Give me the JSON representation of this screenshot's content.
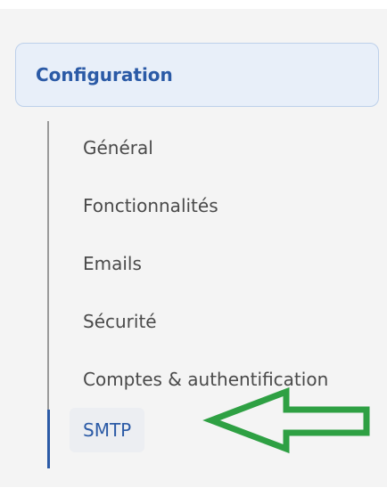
{
  "section": {
    "title": "Configuration"
  },
  "nav": {
    "items": [
      {
        "label": "Général"
      },
      {
        "label": "Fonctionnalités"
      },
      {
        "label": "Emails"
      },
      {
        "label": "Sécurité"
      },
      {
        "label": "Comptes & authentification"
      },
      {
        "label": "SMTP",
        "active": true
      }
    ]
  },
  "colors": {
    "accent": "#2b5aa6",
    "arrow": "#2ea043",
    "text": "#4a4a4a"
  },
  "annotation": {
    "icon": "arrow-left-icon"
  }
}
